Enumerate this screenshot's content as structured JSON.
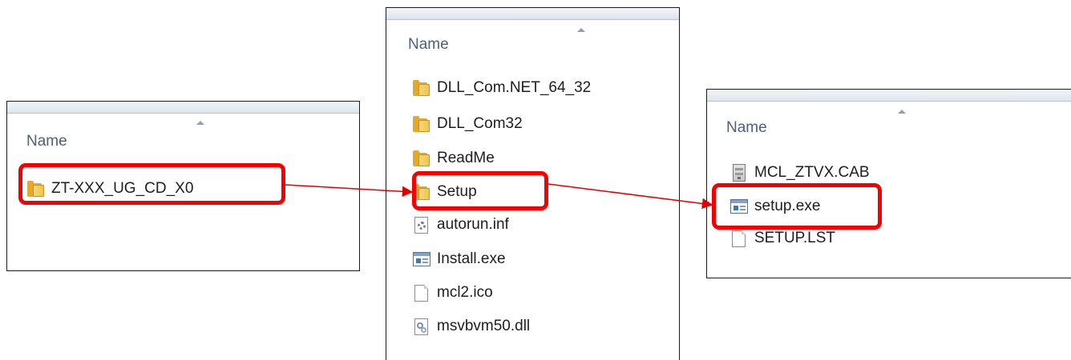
{
  "panes": [
    {
      "header": "Name",
      "items": [
        {
          "label": "ZT-XXX_UG_CD_X0",
          "icon": "folder-icon"
        }
      ]
    },
    {
      "header": "Name",
      "items": [
        {
          "label": "DLL_Com.NET_64_32",
          "icon": "folder-icon"
        },
        {
          "label": "DLL_Com32",
          "icon": "folder-icon"
        },
        {
          "label": "ReadMe",
          "icon": "folder-icon"
        },
        {
          "label": "Setup",
          "icon": "folder-icon"
        },
        {
          "label": "autorun.inf",
          "icon": "settings-file-icon"
        },
        {
          "label": "Install.exe",
          "icon": "application-icon"
        },
        {
          "label": "mcl2.ico",
          "icon": "blank-file-icon"
        },
        {
          "label": "msvbvm50.dll",
          "icon": "dll-file-icon"
        }
      ]
    },
    {
      "header": "Name",
      "items": [
        {
          "label": "MCL_ZTVX.CAB",
          "icon": "cabinet-file-icon"
        },
        {
          "label": "setup.exe",
          "icon": "application-icon"
        },
        {
          "label": "SETUP.LST",
          "icon": "blank-file-icon"
        }
      ]
    }
  ],
  "colors": {
    "highlight": "#f50000",
    "arrow": "#e00000",
    "folder": "#e3a92b",
    "header_text": "#4c607a"
  }
}
